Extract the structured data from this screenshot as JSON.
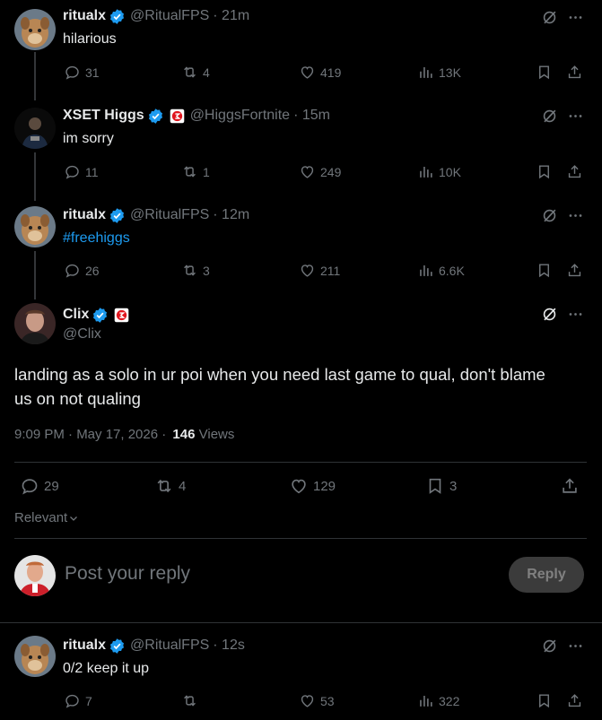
{
  "replies": [
    {
      "name": "ritualx",
      "handle": "@RitualFPS",
      "time": "· 21m",
      "text": "hilarious",
      "stats": {
        "replies": "31",
        "reposts": "4",
        "likes": "419",
        "views": "13K"
      }
    },
    {
      "name": "XSET Higgs",
      "handle": "@HiggsFortnite",
      "time": "· 15m",
      "text": "im sorry",
      "stats": {
        "replies": "11",
        "reposts": "1",
        "likes": "249",
        "views": "10K"
      }
    },
    {
      "name": "ritualx",
      "handle": "@RitualFPS",
      "time": "· 12m",
      "text": "#freehiggs",
      "stats": {
        "replies": "26",
        "reposts": "3",
        "likes": "211",
        "views": "6.6K"
      }
    }
  ],
  "main": {
    "name": "Clix",
    "handle": "@Clix",
    "text_line1": "landing as a solo in ur poi when you need last game to qual, don't blame",
    "text_line2": "us on not qualing",
    "timestamp": "9:09 PM · May 17, 2026 ·",
    "views_count": "146",
    "views_label": "Views",
    "stats": {
      "replies": "29",
      "reposts": "4",
      "likes": "129",
      "bookmarks": "3"
    }
  },
  "sort_label": "Relevant",
  "composer": {
    "placeholder": "Post your reply",
    "button": "Reply"
  },
  "last_reply": {
    "name": "ritualx",
    "handle": "@RitualFPS",
    "time": "· 12s",
    "text": "0/2 keep it up",
    "stats": {
      "replies": "7",
      "reposts": "",
      "likes": "53",
      "views": "322"
    }
  },
  "colors": {
    "accent": "#1d9bf0",
    "verified": "#1d9bf0",
    "muted": "#71767b",
    "badge_red": "#e0161e"
  }
}
